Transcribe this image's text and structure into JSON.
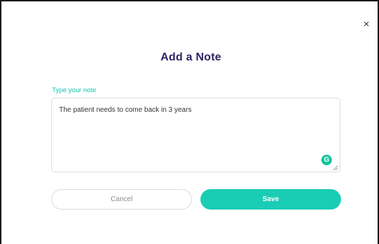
{
  "dialog": {
    "title": "Add a Note",
    "close_label": "×",
    "note_label": "Type your note",
    "note_value": "The patient needs to come back in 3 years",
    "grammarly_label": "G",
    "cancel_label": "Cancel",
    "save_label": "Save"
  },
  "colors": {
    "title": "#2f2563",
    "accent": "#19cdb4",
    "label": "#13c6b0",
    "grammarly": "#15c39a",
    "border": "#d9dde3"
  },
  "icons": {
    "close": "close-icon",
    "grammarly": "grammarly-icon",
    "resize": "resize-handle-icon"
  }
}
